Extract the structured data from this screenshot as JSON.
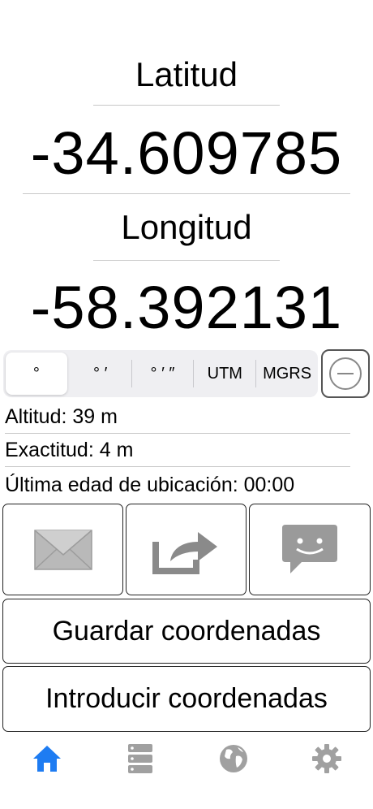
{
  "latitude": {
    "label": "Latitud",
    "value": "-34.609785"
  },
  "longitude": {
    "label": "Longitud",
    "value": "-58.392131"
  },
  "format_selector": {
    "options": [
      "°",
      "° ′",
      "° ′ ″",
      "UTM",
      "MGRS"
    ],
    "selected": "°"
  },
  "info": {
    "altitude": "Altitud: 39 m",
    "accuracy": "Exactitud: 4 m",
    "last_age": "Última edad de ubicación: 00:00"
  },
  "buttons": {
    "save": "Guardar coordenadas",
    "enter": "Introducir coordenadas"
  },
  "tabbar": {
    "items": [
      "home-icon",
      "list-icon",
      "globe-icon",
      "gear-icon"
    ],
    "active": "home-icon"
  },
  "colors": {
    "accent": "#1e7cf2",
    "inactive_icon": "#a0a0a0",
    "action_icon": "#8a8a8a"
  }
}
